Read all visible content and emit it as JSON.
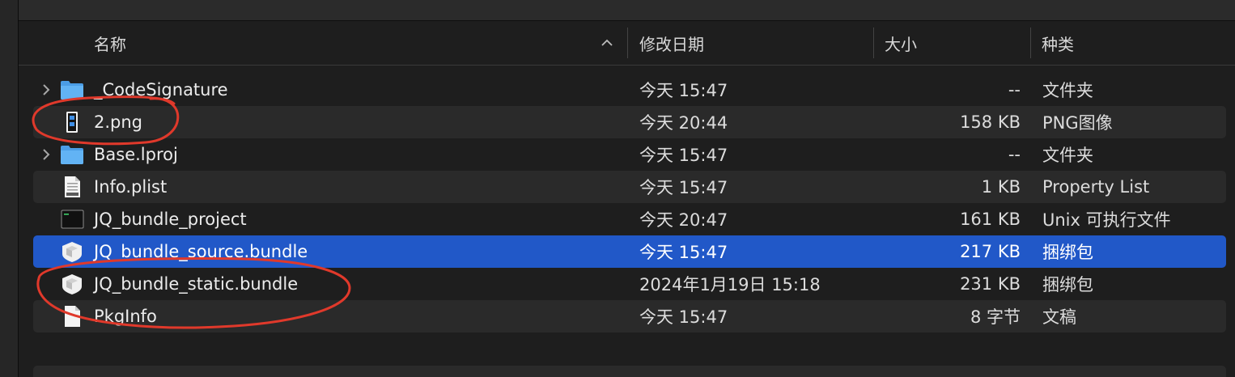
{
  "columns": {
    "name": "名称",
    "date": "修改日期",
    "size": "大小",
    "kind": "种类"
  },
  "files": [
    {
      "name": "_CodeSignature",
      "date": "今天 15:47",
      "size": "--",
      "kind": "文件夹",
      "icon": "folder-icon",
      "expandable": true,
      "selected": false
    },
    {
      "name": "2.png",
      "date": "今天 20:44",
      "size": "158 KB",
      "kind": "PNG图像",
      "icon": "image-file-icon",
      "expandable": false,
      "selected": false
    },
    {
      "name": "Base.lproj",
      "date": "今天 15:47",
      "size": "--",
      "kind": "文件夹",
      "icon": "folder-icon",
      "expandable": true,
      "selected": false
    },
    {
      "name": "Info.plist",
      "date": "今天 15:47",
      "size": "1 KB",
      "kind": "Property List",
      "icon": "plist-file-icon",
      "expandable": false,
      "selected": false
    },
    {
      "name": "JQ_bundle_project",
      "date": "今天 20:47",
      "size": "161 KB",
      "kind": "Unix 可执行文件",
      "icon": "terminal-executable-icon",
      "expandable": false,
      "selected": false
    },
    {
      "name": "JQ_bundle_source.bundle",
      "date": "今天 15:47",
      "size": "217 KB",
      "kind": "捆绑包",
      "icon": "bundle-icon",
      "expandable": false,
      "selected": true
    },
    {
      "name": "JQ_bundle_static.bundle",
      "date": "2024年1月19日 15:18",
      "size": "231 KB",
      "kind": "捆绑包",
      "icon": "bundle-icon",
      "expandable": false,
      "selected": false
    },
    {
      "name": "PkgInfo",
      "date": "今天 15:47",
      "size": "8 字节",
      "kind": "文稿",
      "icon": "document-icon",
      "expandable": false,
      "selected": false
    }
  ],
  "colors": {
    "selection": "#2158c8",
    "annotation": "#e0392b",
    "folder": "#5aabf0"
  }
}
